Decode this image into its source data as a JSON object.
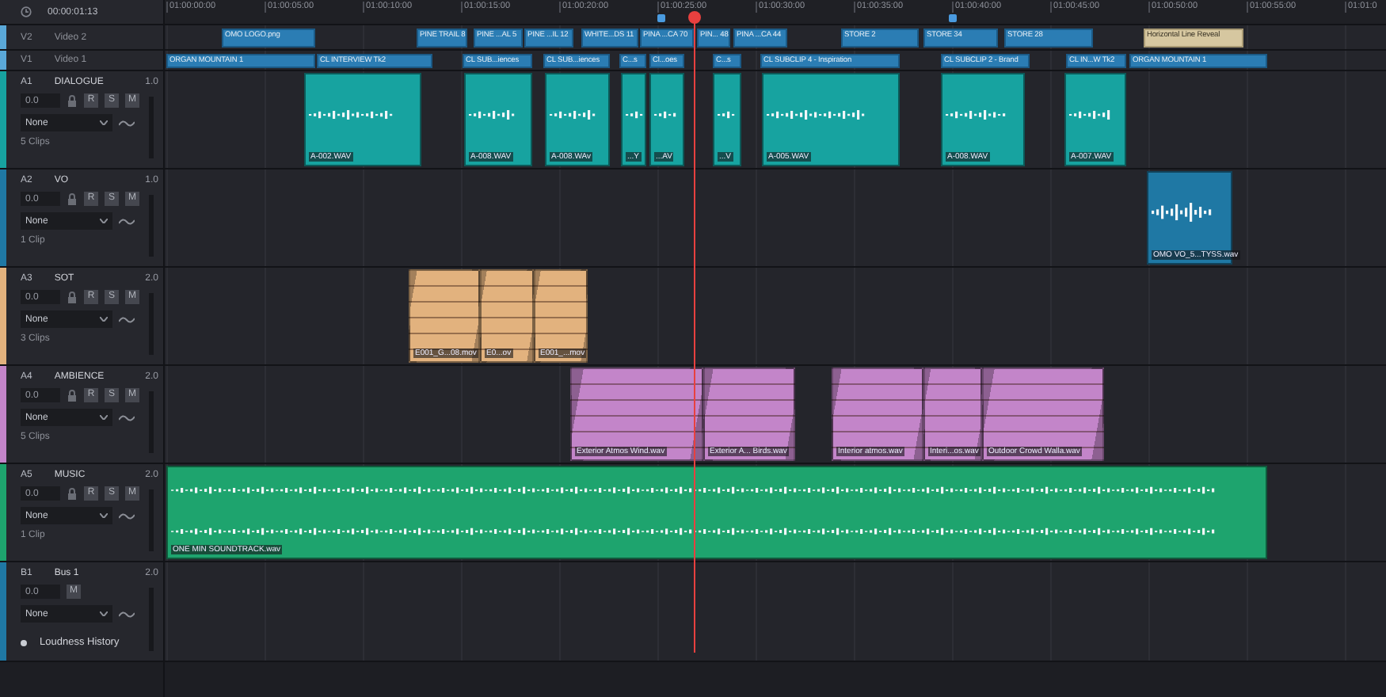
{
  "timecode": "00:00:01:13",
  "ruler": [
    "01:00:00:00",
    "01:00:05:00",
    "01:00:10:00",
    "01:00:15:00",
    "01:00:20:00",
    "01:00:25:00",
    "01:00:30:00",
    "01:00:35:00",
    "01:00:40:00",
    "01:00:45:00",
    "01:00:50:00",
    "01:00:55:00",
    "01:01:0"
  ],
  "video_tracks": [
    {
      "code": "V2",
      "name": "Video 2",
      "color": "#5aa8d8",
      "clips": [
        {
          "label": "OMO LOGO.png",
          "kind": "video"
        },
        {
          "label": "PINE TRAIL 8",
          "kind": "video"
        },
        {
          "label": "PINE ...AL 5",
          "kind": "video"
        },
        {
          "label": "PINE ...IL 12",
          "kind": "video"
        },
        {
          "label": "WHITE...DS 11",
          "kind": "video"
        },
        {
          "label": "PINA ...CA 70",
          "kind": "video"
        },
        {
          "label": "PIN... 48",
          "kind": "video"
        },
        {
          "label": "PINA ...CA 44",
          "kind": "video"
        },
        {
          "label": "STORE 2",
          "kind": "video"
        },
        {
          "label": "STORE 34",
          "kind": "video"
        },
        {
          "label": "STORE 28",
          "kind": "video"
        },
        {
          "label": "Horizontal Line Reveal",
          "kind": "title"
        }
      ]
    },
    {
      "code": "V1",
      "name": "Video 1",
      "color": "#5aa8d8",
      "clips": [
        {
          "label": "ORGAN MOUNTAIN 1",
          "kind": "video"
        },
        {
          "label": "CL INTERVIEW Tk2",
          "kind": "video"
        },
        {
          "label": "CL SUB...iences",
          "kind": "video"
        },
        {
          "label": "CL SUB...iences",
          "kind": "video"
        },
        {
          "label": "C...s",
          "kind": "video"
        },
        {
          "label": "Cl...oes",
          "kind": "video"
        },
        {
          "label": "C...s",
          "kind": "video"
        },
        {
          "label": "CL SUBCLIP 4 - Inspiration",
          "kind": "video"
        },
        {
          "label": "CL SUBCLIP 2 - Brand",
          "kind": "video"
        },
        {
          "label": "CL IN...W Tk2",
          "kind": "video"
        },
        {
          "label": "ORGAN MOUNTAIN 1",
          "kind": "video"
        }
      ]
    }
  ],
  "audio_tracks": [
    {
      "code": "A1",
      "name": "DIALOGUE",
      "gain": "1.0",
      "volume": "0.0",
      "buttons": [
        "R",
        "S",
        "M"
      ],
      "effect": "None",
      "clip_count": "5 Clips",
      "color": "#17a3a0",
      "kind": "wave",
      "clips": [
        "A-002.WAV",
        "A-008.WAV",
        "A-008.WAv",
        "...Y",
        "...AV",
        "...V",
        "A-005.WAV",
        "A-008.WAV",
        "A-007.WAV"
      ]
    },
    {
      "code": "A2",
      "name": "VO",
      "gain": "1.0",
      "volume": "0.0",
      "buttons": [
        "R",
        "S",
        "M"
      ],
      "effect": "None",
      "clip_count": "1 Clip",
      "color": "#1f78a4",
      "kind": "wave",
      "clips": [
        "OMO VO_5...TYSS.wav"
      ]
    },
    {
      "code": "A3",
      "name": "SOT",
      "gain": "2.0",
      "volume": "0.0",
      "buttons": [
        "R",
        "S",
        "M"
      ],
      "effect": "None",
      "clip_count": "3 Clips",
      "color": "#e2b27e",
      "kind": "fade",
      "clips": [
        "E001_G...08.mov",
        "E0...ov",
        "E001_...mov"
      ]
    },
    {
      "code": "A4",
      "name": "AMBIENCE",
      "gain": "2.0",
      "volume": "0.0",
      "buttons": [
        "R",
        "S",
        "M"
      ],
      "effect": "None",
      "clip_count": "5 Clips",
      "color": "#c385c9",
      "kind": "fade",
      "clips": [
        "Exterior Atmos Wind.wav",
        "Exterior A... Birds.wav",
        "Interior atmos.wav",
        "Interi...os.wav",
        "Outdoor Crowd Walla.wav"
      ]
    },
    {
      "code": "A5",
      "name": "MUSIC",
      "gain": "2.0",
      "volume": "0.0",
      "buttons": [
        "R",
        "S",
        "M"
      ],
      "effect": "None",
      "clip_count": "1 Clip",
      "color": "#1ea46e",
      "kind": "wave",
      "clips": [
        "ONE MIN SOUNDTRACK.wav"
      ]
    }
  ],
  "bus": {
    "code": "B1",
    "name": "Bus 1",
    "gain": "2.0",
    "volume": "0.0",
    "buttons": [
      "M"
    ],
    "effect": "None",
    "color": "#1f78a4",
    "loudness_label": "Loudness History"
  }
}
